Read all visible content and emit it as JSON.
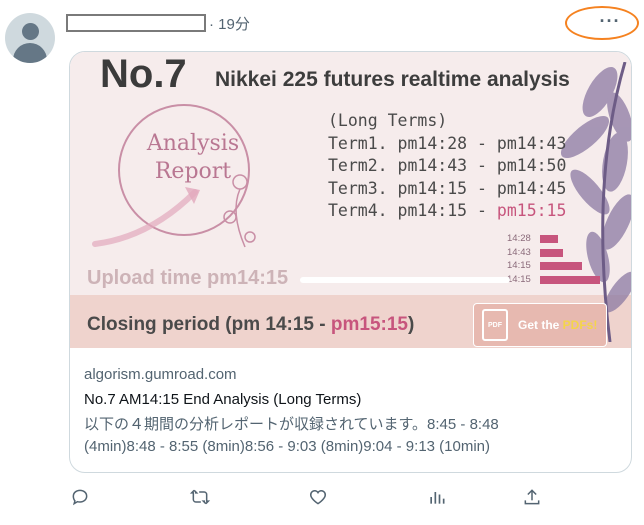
{
  "post": {
    "time": "· 19分",
    "more_label": "···"
  },
  "card": {
    "image": {
      "number": "No.7",
      "headline": "Nikkei 225 futures realtime analysis",
      "report_line1": "Analysis",
      "report_line2": "Report",
      "terms_heading": "(Long Terms)",
      "terms": [
        {
          "label": "Term1. pm14:28 - ",
          "end": "pm14:43"
        },
        {
          "label": "Term2. pm14:43 - ",
          "end": "pm14:50"
        },
        {
          "label": "Term3. pm14:15 - ",
          "end": "pm14:45"
        },
        {
          "label": "Term4. pm14:15 - ",
          "end": "pm15:15"
        }
      ],
      "mini_times": [
        "14:28",
        "14:43",
        "14:15",
        "14:15"
      ],
      "mini_bars": [
        0.2,
        0.25,
        0.45,
        0.65
      ],
      "upload": "Upload time pm14:15",
      "closing_label": "Closing period  (pm 14:15 - ",
      "closing_end": "pm15:15",
      "closing_tail": ")",
      "pdf_icon": "PDF",
      "pdf_text": "Get the ",
      "pdf_text_hl": "PDFs!"
    },
    "domain": "algorism.gumroad.com",
    "title": "No.7 AM14:15 End Analysis (Long Terms)",
    "description_line1": "以下の４期間の分析レポートが収録されています。8:45 - 8:48",
    "description_line2": "(4min)8:48 - 8:55 (8min)8:56 - 9:03 (8min)9:04 - 9:13 (10min)"
  },
  "actions": [
    {
      "icon": "reply-icon"
    },
    {
      "icon": "retweet-icon"
    },
    {
      "icon": "like-icon"
    },
    {
      "icon": "views-icon"
    },
    {
      "icon": "share-icon"
    }
  ],
  "colors": {
    "accent_pink": "#c7557d",
    "annotation_orange": "#f58220",
    "text_secondary": "#536471"
  }
}
